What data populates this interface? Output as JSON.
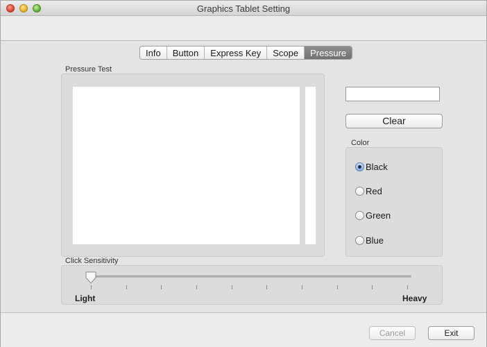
{
  "window": {
    "title": "Graphics Tablet Setting"
  },
  "tabs": [
    {
      "label": "Info",
      "active": false
    },
    {
      "label": "Button",
      "active": false
    },
    {
      "label": "Express Key",
      "active": false
    },
    {
      "label": "Scope",
      "active": false
    },
    {
      "label": "Pressure",
      "active": true
    }
  ],
  "pressure_test": {
    "label": "Pressure Test",
    "pressure_value": "",
    "clear_label": "Clear"
  },
  "color": {
    "label": "Color",
    "options": [
      {
        "label": "Black",
        "selected": true
      },
      {
        "label": "Red",
        "selected": false
      },
      {
        "label": "Green",
        "selected": false
      },
      {
        "label": "Blue",
        "selected": false
      }
    ]
  },
  "click_sensitivity": {
    "label": "Click Sensitivity",
    "min_label": "Light",
    "max_label": "Heavy",
    "value_fraction": 0.0,
    "tick_count": 10
  },
  "footer": {
    "cancel_label": "Cancel",
    "exit_label": "Exit"
  },
  "icons": {
    "close": "close-icon",
    "minimize": "minimize-icon",
    "zoom": "zoom-icon"
  }
}
